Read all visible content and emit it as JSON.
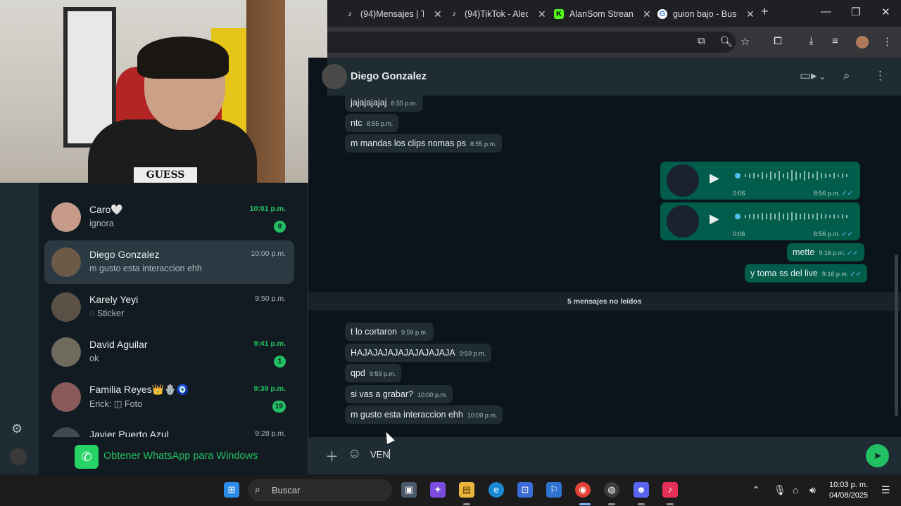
{
  "browser": {
    "tabs": [
      {
        "title": "(94)Mensajes | T",
        "icon": "tiktok-icon"
      },
      {
        "title": "(94)TikTok - Alec",
        "icon": "tiktok-icon"
      },
      {
        "title": "AlanSom Stream",
        "icon": "kick-icon"
      },
      {
        "title": "guion bajo - Bus",
        "icon": "google-icon"
      }
    ],
    "new_tab": "+",
    "window": {
      "minimize": "—",
      "maximize": "❐",
      "close": "✕"
    }
  },
  "sidebar": {
    "settings_icon": "gear-icon",
    "chats": [
      {
        "name": "Caro🤍",
        "preview": "ignora",
        "time": "10:01 p.m.",
        "unread": "8"
      },
      {
        "name": "Diego Gonzalez",
        "preview": "m gusto esta interaccion ehh",
        "time": "10:00 p.m.",
        "unread": ""
      },
      {
        "name": "Karely Yeyi",
        "preview": "◌ Sticker",
        "time": "9:50 p.m.",
        "unread": ""
      },
      {
        "name": "David Aguilar",
        "preview": "ok",
        "time": "9:41 p.m.",
        "unread": "1"
      },
      {
        "name": "Familia Reyes👑🪬🧿",
        "preview": "Erick: ◫ Foto",
        "time": "9:39 p.m.",
        "unread": "19"
      },
      {
        "name": "Javier Puerto Azul",
        "preview": "",
        "time": "9:28 p.m.",
        "unread": ""
      }
    ],
    "promo": "Obtener WhatsApp para Windows"
  },
  "chat": {
    "contact_name": "Diego Gonzalez",
    "messages_before": [
      {
        "text": "jajajajajaj",
        "time": "8:55 p.m.",
        "dir": "in"
      },
      {
        "text": "ntc",
        "time": "8:55 p.m.",
        "dir": "in"
      },
      {
        "text": "m mandas los clips nomas ps",
        "time": "8:55 p.m.",
        "dir": "in"
      }
    ],
    "voice_notes": [
      {
        "duration": "0:06",
        "time": "8:56 p.m."
      },
      {
        "duration": "0:06",
        "time": "8:56 p.m."
      }
    ],
    "messages_out": [
      {
        "text": "mette",
        "time": "9:16 p.m."
      },
      {
        "text": "y toma ss del live",
        "time": "9:16 p.m."
      }
    ],
    "unread_banner": "5 mensajes no leídos",
    "messages_after": [
      {
        "text": "t lo cortaron",
        "time": "9:59 p.m."
      },
      {
        "text": "HAJAJAJAJAJAJAJAJAJA",
        "time": "9:59 p.m."
      },
      {
        "text": "qpd",
        "time": "9:59 p.m."
      },
      {
        "text": "si vas a grabar?",
        "time": "10:00 p.m."
      },
      {
        "text": "m gusto esta interaccion ehh",
        "time": "10:00 p.m."
      }
    ],
    "composer_value": "VEN"
  },
  "taskbar": {
    "search_label": "Buscar",
    "time": "10:03 p. m.",
    "date": "04/08/2025"
  },
  "colors": {
    "accent": "#21c063",
    "outgoing_bubble": "#005c4b",
    "incoming_bubble": "#202c33",
    "background": "#0b141a"
  }
}
